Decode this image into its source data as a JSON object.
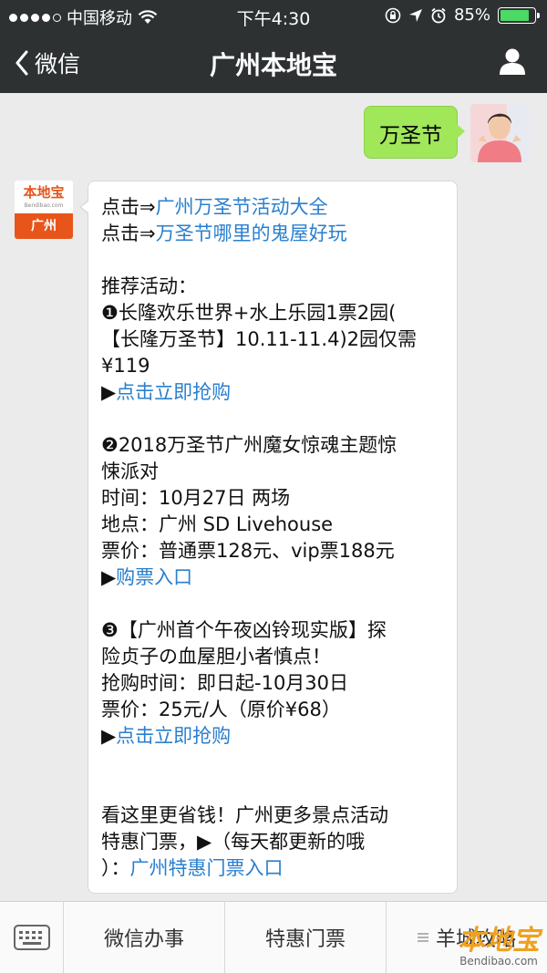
{
  "status_bar": {
    "carrier": "中国移动",
    "time": "下午4:30",
    "battery_percent": "85%",
    "battery_level": 0.85
  },
  "nav": {
    "back_label": "微信",
    "title": "广州本地宝"
  },
  "sent_message": {
    "text": "万圣节"
  },
  "reply": {
    "avatar_top": "本地宝",
    "avatar_url_text": "Bendibao.com",
    "avatar_city": "广州",
    "lines": [
      {
        "prefix": "点击⇒",
        "link": "广州万圣节活动大全",
        "text": ""
      },
      {
        "prefix": "点击⇒",
        "link": "万圣节哪里的鬼屋好玩",
        "text": ""
      },
      {
        "prefix": "",
        "link": "",
        "text": ""
      },
      {
        "prefix": "",
        "link": "",
        "text": "推荐活动："
      },
      {
        "prefix": "",
        "link": "",
        "text": "❶长隆欢乐世界+水上乐园1票2园("
      },
      {
        "prefix": "",
        "link": "",
        "text": "【长隆万圣节】10.11-11.4)2园仅需"
      },
      {
        "prefix": "",
        "link": "",
        "text": "¥119"
      },
      {
        "prefix": "▶",
        "link": "点击立即抢购",
        "text": ""
      },
      {
        "prefix": "",
        "link": "",
        "text": ""
      },
      {
        "prefix": "",
        "link": "",
        "text": "❷2018万圣节广州魔女惊魂主题惊"
      },
      {
        "prefix": "",
        "link": "",
        "text": "悚派对"
      },
      {
        "prefix": "",
        "link": "",
        "text": "时间：10月27日 两场"
      },
      {
        "prefix": "",
        "link": "",
        "text": "地点：广州 SD Livehouse"
      },
      {
        "prefix": "",
        "link": "",
        "text": "票价：普通票128元、vip票188元"
      },
      {
        "prefix": "▶",
        "link": "购票入口",
        "text": ""
      },
      {
        "prefix": "",
        "link": "",
        "text": ""
      },
      {
        "prefix": "",
        "link": "",
        "text": "❸【广州首个午夜凶铃现实版】探"
      },
      {
        "prefix": "",
        "link": "",
        "text": "险贞子の血屋胆小者慎点！"
      },
      {
        "prefix": "",
        "link": "",
        "text": "抢购时间：即日起-10月30日"
      },
      {
        "prefix": "",
        "link": "",
        "text": "票价：25元/人（原价¥68）"
      },
      {
        "prefix": "▶",
        "link": "点击立即抢购",
        "text": ""
      },
      {
        "prefix": "",
        "link": "",
        "text": ""
      },
      {
        "prefix": "",
        "link": "",
        "text": ""
      },
      {
        "prefix": "",
        "link": "",
        "text": "看这里更省钱！广州更多景点活动"
      },
      {
        "prefix": "",
        "link": "",
        "text": "特惠门票，▶（每天都更新的哦"
      },
      {
        "prefix": "）：",
        "link": "广州特惠门票入口",
        "text": ""
      }
    ]
  },
  "bottom_menu": {
    "items": [
      "微信办事",
      "特惠门票",
      "羊城攻略"
    ]
  },
  "watermark": {
    "brand": "本地宝",
    "url": "Bendibao.com"
  },
  "colors": {
    "nav_bg": "#2e3132",
    "chat_bg": "#ebebeb",
    "sent_bubble": "#a0e75a",
    "link": "#2a7fce",
    "brand_orange": "#e8551a",
    "battery_green": "#4cd964"
  },
  "icons": [
    "signal-dots",
    "wifi-icon",
    "lock-rotation-icon",
    "location-icon",
    "alarm-icon",
    "battery-icon",
    "back-chevron-icon",
    "profile-icon",
    "keyboard-icon",
    "menu-list-icon"
  ]
}
